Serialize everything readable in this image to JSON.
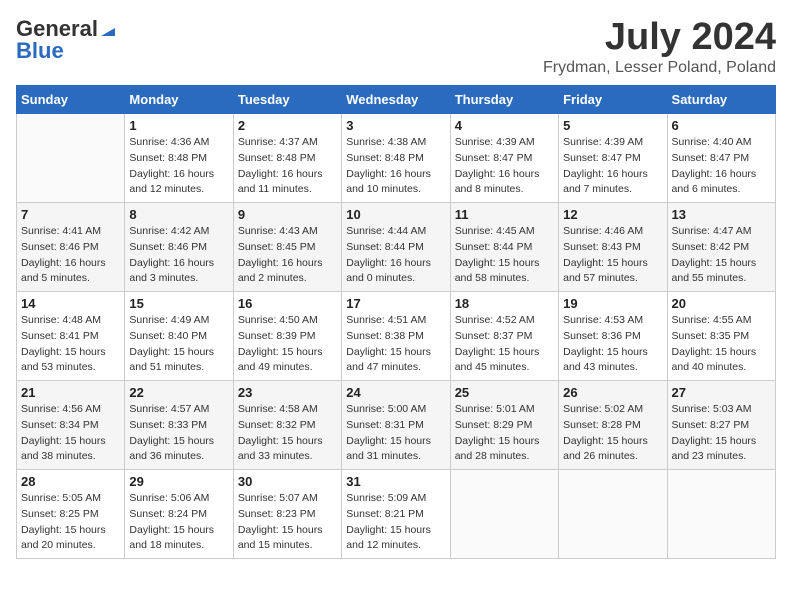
{
  "header": {
    "logo_general": "General",
    "logo_blue": "Blue",
    "month": "July 2024",
    "location": "Frydman, Lesser Poland, Poland"
  },
  "days_of_week": [
    "Sunday",
    "Monday",
    "Tuesday",
    "Wednesday",
    "Thursday",
    "Friday",
    "Saturday"
  ],
  "weeks": [
    [
      {
        "num": "",
        "sunrise": "",
        "sunset": "",
        "daylight": ""
      },
      {
        "num": "1",
        "sunrise": "Sunrise: 4:36 AM",
        "sunset": "Sunset: 8:48 PM",
        "daylight": "Daylight: 16 hours and 12 minutes."
      },
      {
        "num": "2",
        "sunrise": "Sunrise: 4:37 AM",
        "sunset": "Sunset: 8:48 PM",
        "daylight": "Daylight: 16 hours and 11 minutes."
      },
      {
        "num": "3",
        "sunrise": "Sunrise: 4:38 AM",
        "sunset": "Sunset: 8:48 PM",
        "daylight": "Daylight: 16 hours and 10 minutes."
      },
      {
        "num": "4",
        "sunrise": "Sunrise: 4:39 AM",
        "sunset": "Sunset: 8:47 PM",
        "daylight": "Daylight: 16 hours and 8 minutes."
      },
      {
        "num": "5",
        "sunrise": "Sunrise: 4:39 AM",
        "sunset": "Sunset: 8:47 PM",
        "daylight": "Daylight: 16 hours and 7 minutes."
      },
      {
        "num": "6",
        "sunrise": "Sunrise: 4:40 AM",
        "sunset": "Sunset: 8:47 PM",
        "daylight": "Daylight: 16 hours and 6 minutes."
      }
    ],
    [
      {
        "num": "7",
        "sunrise": "Sunrise: 4:41 AM",
        "sunset": "Sunset: 8:46 PM",
        "daylight": "Daylight: 16 hours and 5 minutes."
      },
      {
        "num": "8",
        "sunrise": "Sunrise: 4:42 AM",
        "sunset": "Sunset: 8:46 PM",
        "daylight": "Daylight: 16 hours and 3 minutes."
      },
      {
        "num": "9",
        "sunrise": "Sunrise: 4:43 AM",
        "sunset": "Sunset: 8:45 PM",
        "daylight": "Daylight: 16 hours and 2 minutes."
      },
      {
        "num": "10",
        "sunrise": "Sunrise: 4:44 AM",
        "sunset": "Sunset: 8:44 PM",
        "daylight": "Daylight: 16 hours and 0 minutes."
      },
      {
        "num": "11",
        "sunrise": "Sunrise: 4:45 AM",
        "sunset": "Sunset: 8:44 PM",
        "daylight": "Daylight: 15 hours and 58 minutes."
      },
      {
        "num": "12",
        "sunrise": "Sunrise: 4:46 AM",
        "sunset": "Sunset: 8:43 PM",
        "daylight": "Daylight: 15 hours and 57 minutes."
      },
      {
        "num": "13",
        "sunrise": "Sunrise: 4:47 AM",
        "sunset": "Sunset: 8:42 PM",
        "daylight": "Daylight: 15 hours and 55 minutes."
      }
    ],
    [
      {
        "num": "14",
        "sunrise": "Sunrise: 4:48 AM",
        "sunset": "Sunset: 8:41 PM",
        "daylight": "Daylight: 15 hours and 53 minutes."
      },
      {
        "num": "15",
        "sunrise": "Sunrise: 4:49 AM",
        "sunset": "Sunset: 8:40 PM",
        "daylight": "Daylight: 15 hours and 51 minutes."
      },
      {
        "num": "16",
        "sunrise": "Sunrise: 4:50 AM",
        "sunset": "Sunset: 8:39 PM",
        "daylight": "Daylight: 15 hours and 49 minutes."
      },
      {
        "num": "17",
        "sunrise": "Sunrise: 4:51 AM",
        "sunset": "Sunset: 8:38 PM",
        "daylight": "Daylight: 15 hours and 47 minutes."
      },
      {
        "num": "18",
        "sunrise": "Sunrise: 4:52 AM",
        "sunset": "Sunset: 8:37 PM",
        "daylight": "Daylight: 15 hours and 45 minutes."
      },
      {
        "num": "19",
        "sunrise": "Sunrise: 4:53 AM",
        "sunset": "Sunset: 8:36 PM",
        "daylight": "Daylight: 15 hours and 43 minutes."
      },
      {
        "num": "20",
        "sunrise": "Sunrise: 4:55 AM",
        "sunset": "Sunset: 8:35 PM",
        "daylight": "Daylight: 15 hours and 40 minutes."
      }
    ],
    [
      {
        "num": "21",
        "sunrise": "Sunrise: 4:56 AM",
        "sunset": "Sunset: 8:34 PM",
        "daylight": "Daylight: 15 hours and 38 minutes."
      },
      {
        "num": "22",
        "sunrise": "Sunrise: 4:57 AM",
        "sunset": "Sunset: 8:33 PM",
        "daylight": "Daylight: 15 hours and 36 minutes."
      },
      {
        "num": "23",
        "sunrise": "Sunrise: 4:58 AM",
        "sunset": "Sunset: 8:32 PM",
        "daylight": "Daylight: 15 hours and 33 minutes."
      },
      {
        "num": "24",
        "sunrise": "Sunrise: 5:00 AM",
        "sunset": "Sunset: 8:31 PM",
        "daylight": "Daylight: 15 hours and 31 minutes."
      },
      {
        "num": "25",
        "sunrise": "Sunrise: 5:01 AM",
        "sunset": "Sunset: 8:29 PM",
        "daylight": "Daylight: 15 hours and 28 minutes."
      },
      {
        "num": "26",
        "sunrise": "Sunrise: 5:02 AM",
        "sunset": "Sunset: 8:28 PM",
        "daylight": "Daylight: 15 hours and 26 minutes."
      },
      {
        "num": "27",
        "sunrise": "Sunrise: 5:03 AM",
        "sunset": "Sunset: 8:27 PM",
        "daylight": "Daylight: 15 hours and 23 minutes."
      }
    ],
    [
      {
        "num": "28",
        "sunrise": "Sunrise: 5:05 AM",
        "sunset": "Sunset: 8:25 PM",
        "daylight": "Daylight: 15 hours and 20 minutes."
      },
      {
        "num": "29",
        "sunrise": "Sunrise: 5:06 AM",
        "sunset": "Sunset: 8:24 PM",
        "daylight": "Daylight: 15 hours and 18 minutes."
      },
      {
        "num": "30",
        "sunrise": "Sunrise: 5:07 AM",
        "sunset": "Sunset: 8:23 PM",
        "daylight": "Daylight: 15 hours and 15 minutes."
      },
      {
        "num": "31",
        "sunrise": "Sunrise: 5:09 AM",
        "sunset": "Sunset: 8:21 PM",
        "daylight": "Daylight: 15 hours and 12 minutes."
      },
      {
        "num": "",
        "sunrise": "",
        "sunset": "",
        "daylight": ""
      },
      {
        "num": "",
        "sunrise": "",
        "sunset": "",
        "daylight": ""
      },
      {
        "num": "",
        "sunrise": "",
        "sunset": "",
        "daylight": ""
      }
    ]
  ]
}
